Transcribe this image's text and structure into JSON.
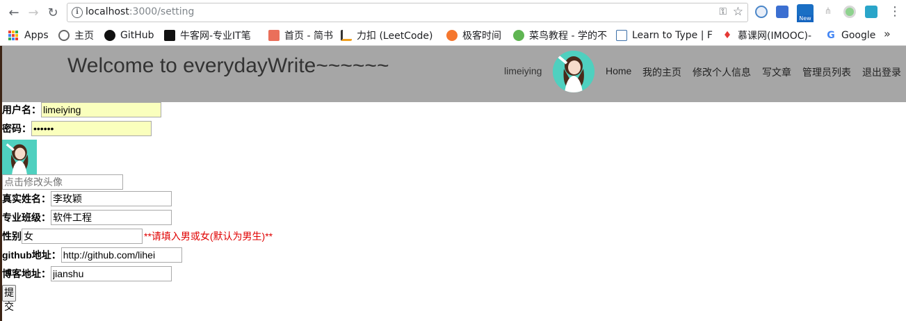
{
  "browser": {
    "url_host": "localhost",
    "url_path": ":3000/setting",
    "ext_badge": "New",
    "bookmarks": [
      {
        "label": "Apps",
        "icon": "apps-icon"
      },
      {
        "label": "主页",
        "icon": "home-globe-icon"
      },
      {
        "label": "GitHub",
        "icon": "github-icon"
      },
      {
        "label": "牛客网-专业IT笔",
        "icon": "nowcoder-icon"
      },
      {
        "label": "首页 - 简书",
        "icon": "jianshu-icon"
      },
      {
        "label": "力扣 (LeetCode)",
        "icon": "leetcode-icon"
      },
      {
        "label": "极客时间",
        "icon": "geektime-icon"
      },
      {
        "label": "菜鸟教程 - 学的不",
        "icon": "runoob-icon"
      },
      {
        "label": "Learn to Type | F",
        "icon": "typing-icon"
      },
      {
        "label": "慕课网(IMOOC)-",
        "icon": "imooc-icon"
      },
      {
        "label": "Google",
        "icon": "google-icon"
      }
    ],
    "more_glyph": "»"
  },
  "site": {
    "title": "Welcome to everydayWrite~~~~~~",
    "username": "limeiying",
    "nav": [
      "Home",
      "我的主页",
      "修改个人信息",
      "写文章",
      "管理员列表",
      "退出登录"
    ],
    "header_color": "#a6a6a6"
  },
  "form": {
    "username_label": "用户名：",
    "username_value": "limeiying",
    "password_label": "密码：",
    "password_value": "••••••",
    "avatar_input_placeholder": "点击修改头像",
    "realname_label": "真实姓名：",
    "realname_value": "李玫颖",
    "major_label": "专业班级：",
    "major_value": "软件工程",
    "gender_label": "性别",
    "gender_value": "女",
    "gender_hint": "**请填入男或女(默认为男生)**",
    "github_label": "github地址：",
    "github_value": "http://github.com/lihei",
    "blog_label": "博客地址：",
    "blog_value": "jianshu",
    "submit_label": "提交"
  },
  "colors": {
    "autofill": "#faffbd",
    "hint": "#e00000",
    "avatar_bg": "#4fd0bf"
  }
}
